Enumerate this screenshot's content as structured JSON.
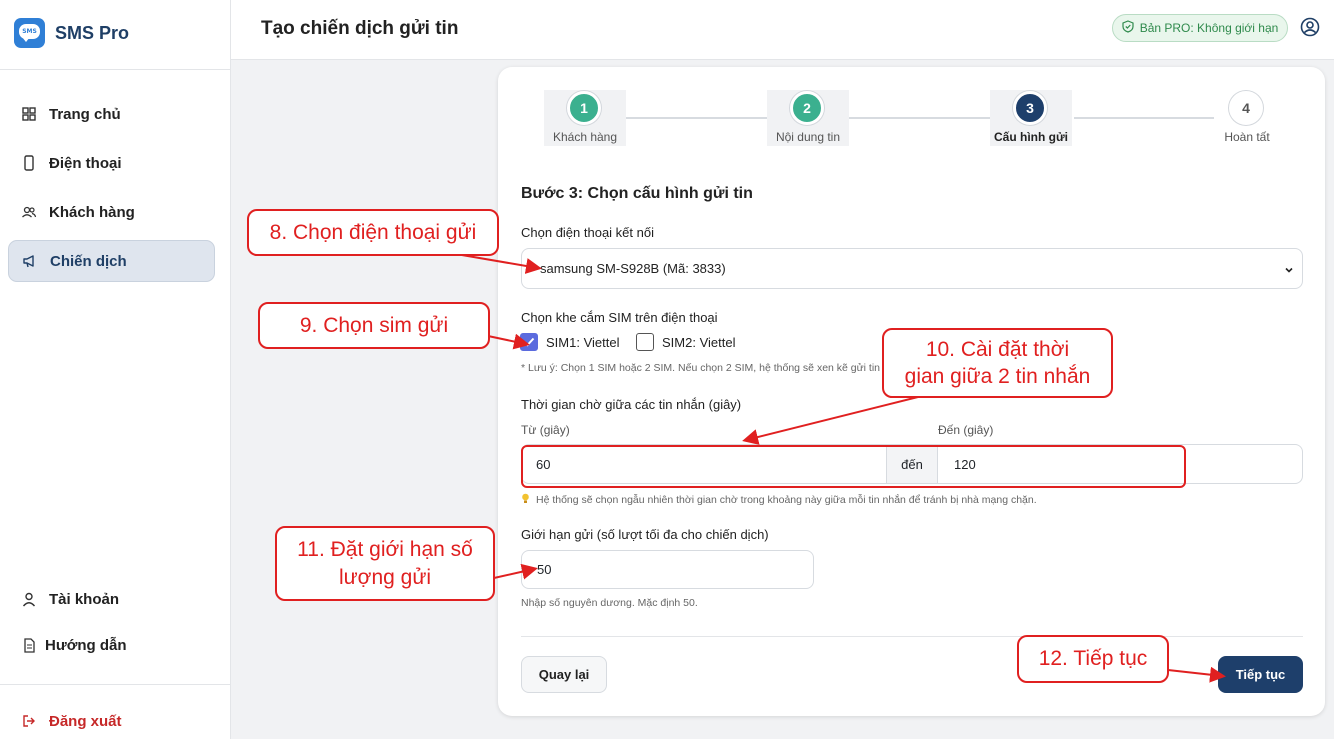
{
  "app": {
    "name": "SMS Pro",
    "logo_text": "SMS"
  },
  "sidebar": {
    "items": [
      {
        "label": "Trang chủ",
        "icon": "grid-icon"
      },
      {
        "label": "Điện thoại",
        "icon": "phone-icon"
      },
      {
        "label": "Khách hàng",
        "icon": "users-icon"
      },
      {
        "label": "Chiến dịch",
        "icon": "megaphone-icon",
        "active": true
      }
    ],
    "bottom_items": [
      {
        "label": "Tài khoản",
        "icon": "user-icon"
      },
      {
        "label": "Hướng dẫn",
        "icon": "document-icon"
      }
    ],
    "logout_label": "Đăng xuất"
  },
  "header": {
    "title": "Tạo chiến dịch gửi tin",
    "pro_badge": "Bản PRO: Không giới hạn"
  },
  "stepper": {
    "steps": [
      {
        "number": "1",
        "label": "Khách hàng",
        "state": "done"
      },
      {
        "number": "2",
        "label": "Nội dung tin",
        "state": "done"
      },
      {
        "number": "3",
        "label": "Cấu hình gửi",
        "state": "current"
      },
      {
        "number": "4",
        "label": "Hoàn tất",
        "state": "todo"
      }
    ]
  },
  "form": {
    "section_title": "Bước 3: Chọn cấu hình gửi tin",
    "phone_label": "Chọn điện thoại kết nối",
    "phone_value": "samsung SM-S928B (Mã: 3833)",
    "sim_label": "Chọn khe cắm SIM trên điện thoại",
    "sim1_label": "SIM1: Viettel",
    "sim1_checked": true,
    "sim2_label": "SIM2: Viettel",
    "sim2_checked": false,
    "sim_note": "* Lưu ý: Chọn 1 SIM hoặc 2 SIM. Nếu chọn 2 SIM, hệ thống sẽ xen kẽ gửi tin t",
    "wait_label": "Thời gian chờ giữa các tin nhắn (giây)",
    "from_label": "Từ (giây)",
    "to_label": "Đến (giây)",
    "from_value": "60",
    "separator": "đến",
    "to_value": "120",
    "wait_note": "Hệ thống sẽ chọn ngẫu nhiên thời gian chờ trong khoảng này giữa mỗi tin nhắn để tránh bị nhà mạng chặn.",
    "limit_label": "Giới hạn gửi (số lượt tối đa cho chiến dịch)",
    "limit_value": "50",
    "limit_note": "Nhập số nguyên dương. Mặc định 50.",
    "back_label": "Quay lại",
    "next_label": "Tiếp tục"
  },
  "annotations": {
    "a8": "8. Chọn điện thoại gửi",
    "a9": "9. Chọn sim gửi",
    "a10_line1": "10. Cài đặt thời",
    "a10_line2": "gian giữa 2 tin nhắn",
    "a11_line1": "11. Đặt giới hạn số",
    "a11_line2": "lượng gửi",
    "a12": "12. Tiếp tục",
    "color": "#e02020"
  },
  "colors": {
    "primary": "#1e3f6b",
    "done": "#3bb08f",
    "brand": "#2f7fd6",
    "logout": "#c62828"
  }
}
